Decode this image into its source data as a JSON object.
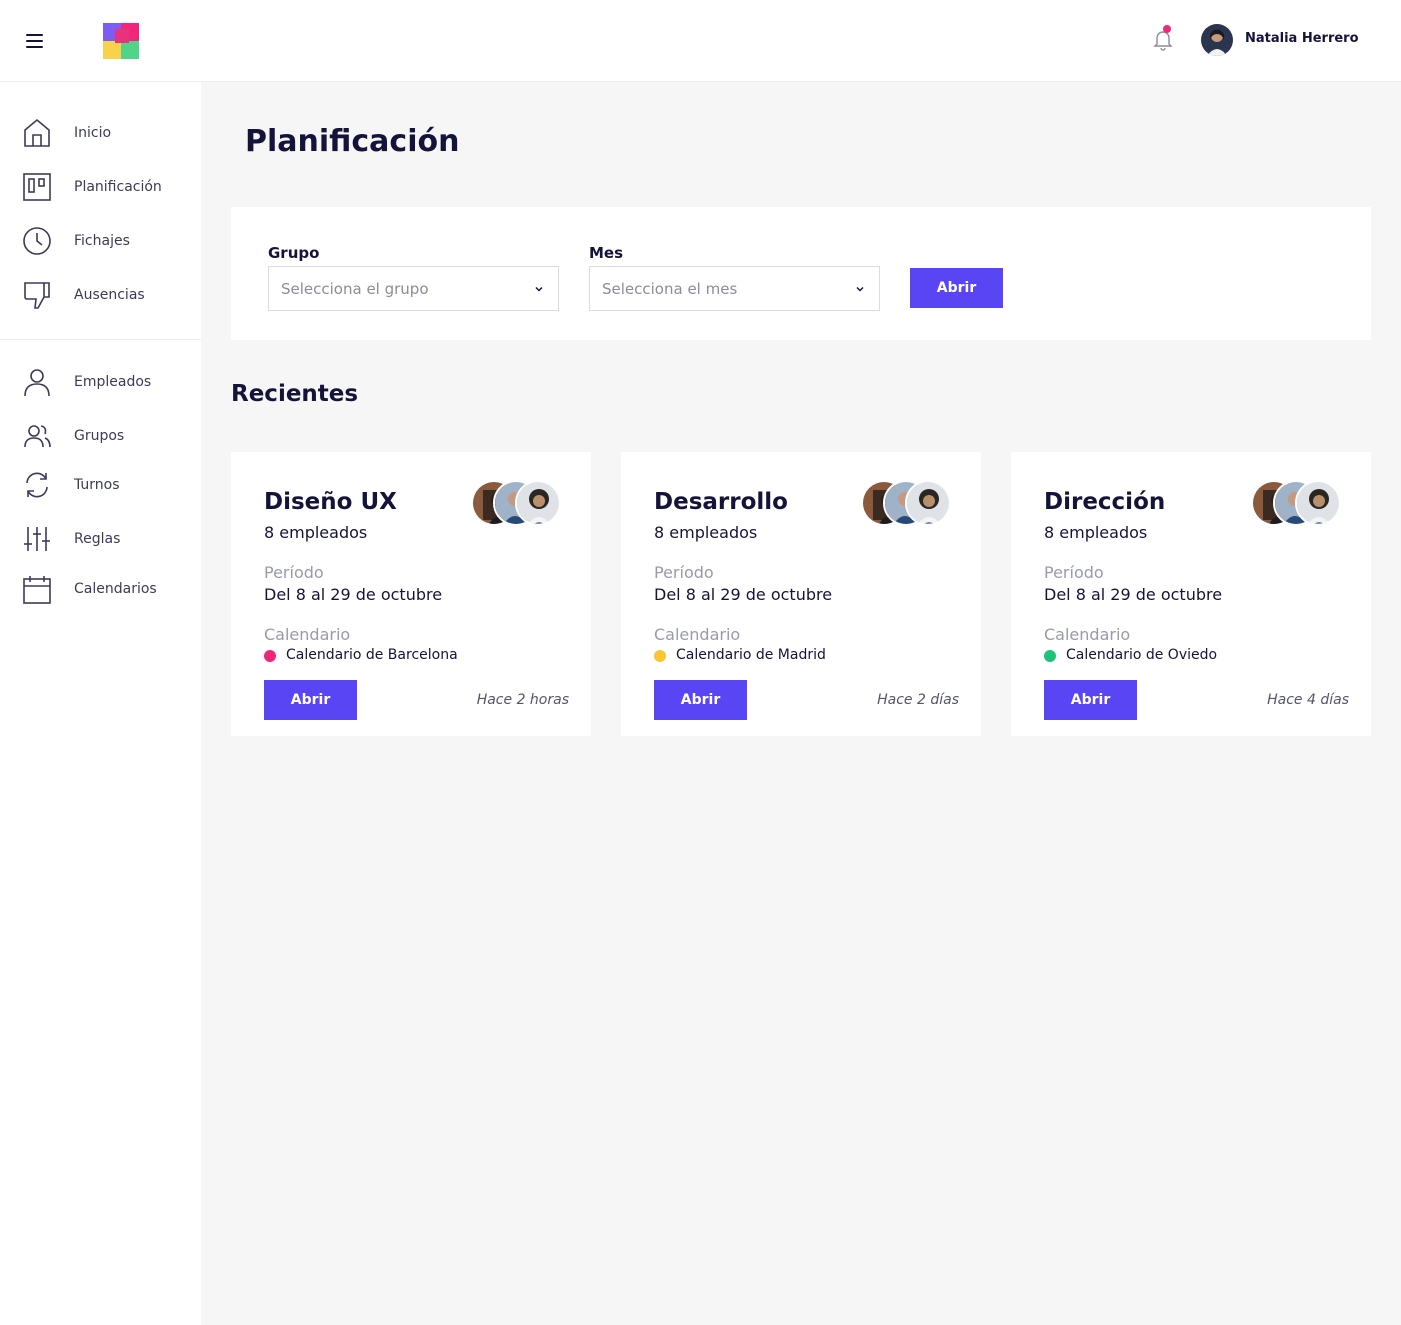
{
  "header": {
    "user_name": "Natalia Herrero",
    "has_notification": true,
    "accent_color": "#5a45f5",
    "notification_color": "#f0267a"
  },
  "sidebar": {
    "items": [
      {
        "label": "Inicio",
        "icon": "home-icon"
      },
      {
        "label": "Planificación",
        "icon": "kanban-board-icon"
      },
      {
        "label": "Fichajes",
        "icon": "clock-icon"
      },
      {
        "label": "Ausencias",
        "icon": "thumbs-down-icon"
      },
      {
        "label": "Empleados",
        "icon": "user-icon"
      },
      {
        "label": "Grupos",
        "icon": "users-icon"
      },
      {
        "label": "Turnos",
        "icon": "refresh-icon"
      },
      {
        "label": "Reglas",
        "icon": "sliders-icon"
      },
      {
        "label": "Calendarios",
        "icon": "calendar-icon"
      }
    ]
  },
  "main": {
    "title": "Planificación",
    "filter": {
      "group_label": "Grupo",
      "group_placeholder": "Selecciona el grupo",
      "month_label": "Mes",
      "month_placeholder": "Selecciona el mes",
      "open_button": "Abrir"
    },
    "recent_title": "Recientes",
    "cards": [
      {
        "title": "Diseño UX",
        "employees": "8 empleados",
        "period_label": "Período",
        "period": "Del 8 al 29 de octubre",
        "calendar_label": "Calendario",
        "calendar": "Calendario de Barcelona",
        "calendar_color": "#f0267a",
        "button": "Abrir",
        "time": "Hace 2 horas"
      },
      {
        "title": "Desarrollo",
        "employees": "8 empleados",
        "period_label": "Período",
        "period": "Del 8 al 29 de octubre",
        "calendar_label": "Calendario",
        "calendar": "Calendario de Madrid",
        "calendar_color": "#f8c630",
        "button": "Abrir",
        "time": "Hace 2 días"
      },
      {
        "title": "Dirección",
        "employees": "8 empleados",
        "period_label": "Período",
        "period": "Del 8 al 29 de octubre",
        "calendar_label": "Calendario",
        "calendar": "Calendario de Oviedo",
        "calendar_color": "#1fc27c",
        "button": "Abrir",
        "time": "Hace 4 días"
      }
    ]
  }
}
